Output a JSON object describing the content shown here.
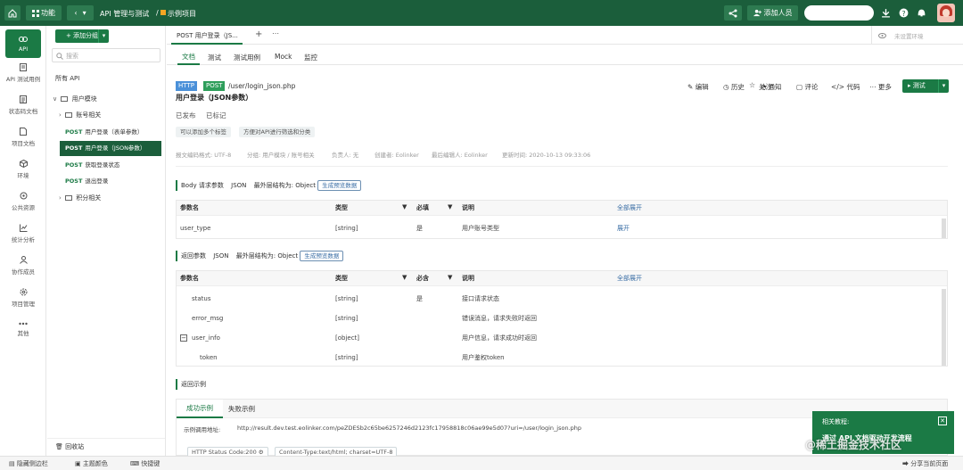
{
  "topbar": {
    "menu_label": "功能",
    "breadcrumb_root": "API 管理与测试",
    "breadcrumb_sep": "/",
    "breadcrumb_project": "示例项目",
    "add_member_label": "添加人员"
  },
  "leftnav": {
    "items": [
      {
        "label": "API",
        "icon": "link-icon"
      },
      {
        "label": "API 测试用例",
        "icon": "test-icon"
      },
      {
        "label": "状态码文档",
        "icon": "document-icon"
      },
      {
        "label": "项目文档",
        "icon": "file-icon"
      },
      {
        "label": "环境",
        "icon": "cube-icon"
      },
      {
        "label": "公共资源",
        "icon": "resource-icon"
      },
      {
        "label": "统计分析",
        "icon": "chart-icon"
      },
      {
        "label": "协作成员",
        "icon": "users-icon"
      },
      {
        "label": "项目管理",
        "icon": "gear-icon"
      },
      {
        "label": "其他",
        "icon": "more-icon"
      }
    ]
  },
  "tree": {
    "add_group_label": "+ 添加分组",
    "search_placeholder": "搜索",
    "all_api": "所有 API",
    "nodes": [
      {
        "label": "用户模块",
        "type": "folder"
      },
      {
        "label": "账号相关",
        "type": "folder"
      },
      {
        "method": "POST",
        "label": "用户登录（表单参数）",
        "type": "api"
      },
      {
        "method": "POST",
        "label": "用户登录（JSON参数）",
        "type": "api",
        "active": true
      },
      {
        "method": "POST",
        "label": "获取登录状态",
        "type": "api"
      },
      {
        "method": "POST",
        "label": "退出登录",
        "type": "api"
      },
      {
        "label": "积分相关",
        "type": "folder"
      }
    ],
    "recycle_label": "回收站"
  },
  "tabs": {
    "open_tab": "POST 用户登录（JS...",
    "env_placeholder": "未设置环境"
  },
  "subtabs": [
    "文档",
    "测试",
    "测试用例",
    "Mock",
    "监控"
  ],
  "api": {
    "protocol": "HTTP",
    "method": "POST",
    "path": "/user/login_json.php",
    "name": "用户登录（JSON参数）",
    "status": "已发布",
    "marked": "已标记",
    "tag_hint_1": "可以添加多个标签",
    "tag_hint_2": "方便对API进行筛选和分类",
    "meta": [
      "报文编码格式: UTF-8",
      "分组: 用户模块 / 账号相关",
      "负责人: 无",
      "创建者: Eolinker",
      "最后编辑人: Eolinker",
      "更新时间: 2020-10-13 09:33:06"
    ]
  },
  "actions": {
    "edit": "编辑",
    "history": "历史",
    "watch": "关注",
    "notify": "通知",
    "comment": "评论",
    "code": "代码",
    "more": "更多",
    "test": "测试"
  },
  "body_section": {
    "title": "Body 请求参数",
    "format": "JSON",
    "outer_label": "最外层结构为: Object",
    "gen_btn": "生成预览数据",
    "headers": [
      "参数名",
      "类型",
      "必填",
      "说明",
      "全部展开"
    ],
    "rows": [
      {
        "name": "user_type",
        "type": "[string]",
        "required": "是",
        "desc": "用户账号类型",
        "action": "展开"
      }
    ]
  },
  "return_section": {
    "title": "返回参数",
    "format": "JSON",
    "outer_label": "最外层结构为: Object",
    "gen_btn": "生成预览数据",
    "headers": [
      "参数名",
      "类型",
      "必含",
      "说明",
      "全部展开"
    ],
    "rows": [
      {
        "name": "status",
        "type": "[string]",
        "required": "是",
        "desc": "接口请求状态"
      },
      {
        "name": "error_msg",
        "type": "[string]",
        "required": "",
        "desc": "错误消息，请求失败时返回"
      },
      {
        "name": "user_info",
        "type": "[object]",
        "required": "",
        "desc": "用户信息，请求成功时返回"
      },
      {
        "name": "token",
        "type": "[string]",
        "required": "",
        "desc": "用户鉴权token"
      }
    ]
  },
  "example_section": {
    "title": "返回示例",
    "tab_success": "成功示例",
    "tab_fail": "失败示例",
    "url_label": "示例调用地址:",
    "url": "http://result.dev.test.eolinker.com/peZDESb2c65be6257246d2123fc17958818c06ae99e5d07?uri=/user/login_json.php",
    "status_tag": "HTTP Status Code:200",
    "ctype_tag": "Content-Type:text/html; charset=UTF-8"
  },
  "popup": {
    "title": "相关教程:",
    "link": "通过 API 文档驱动开发流程",
    "watermark": "@稀土掘金技术社区"
  },
  "statusbar": {
    "hide_sidebar": "隐藏侧边栏",
    "theme": "主题颜色",
    "shortcut": "快捷键",
    "share": "分享当前页面"
  },
  "colors": {
    "brand": "#1b5e3b",
    "accent": "#1b7a45",
    "http_tag": "#4a90d9",
    "post_tag": "#2e9e5b"
  }
}
